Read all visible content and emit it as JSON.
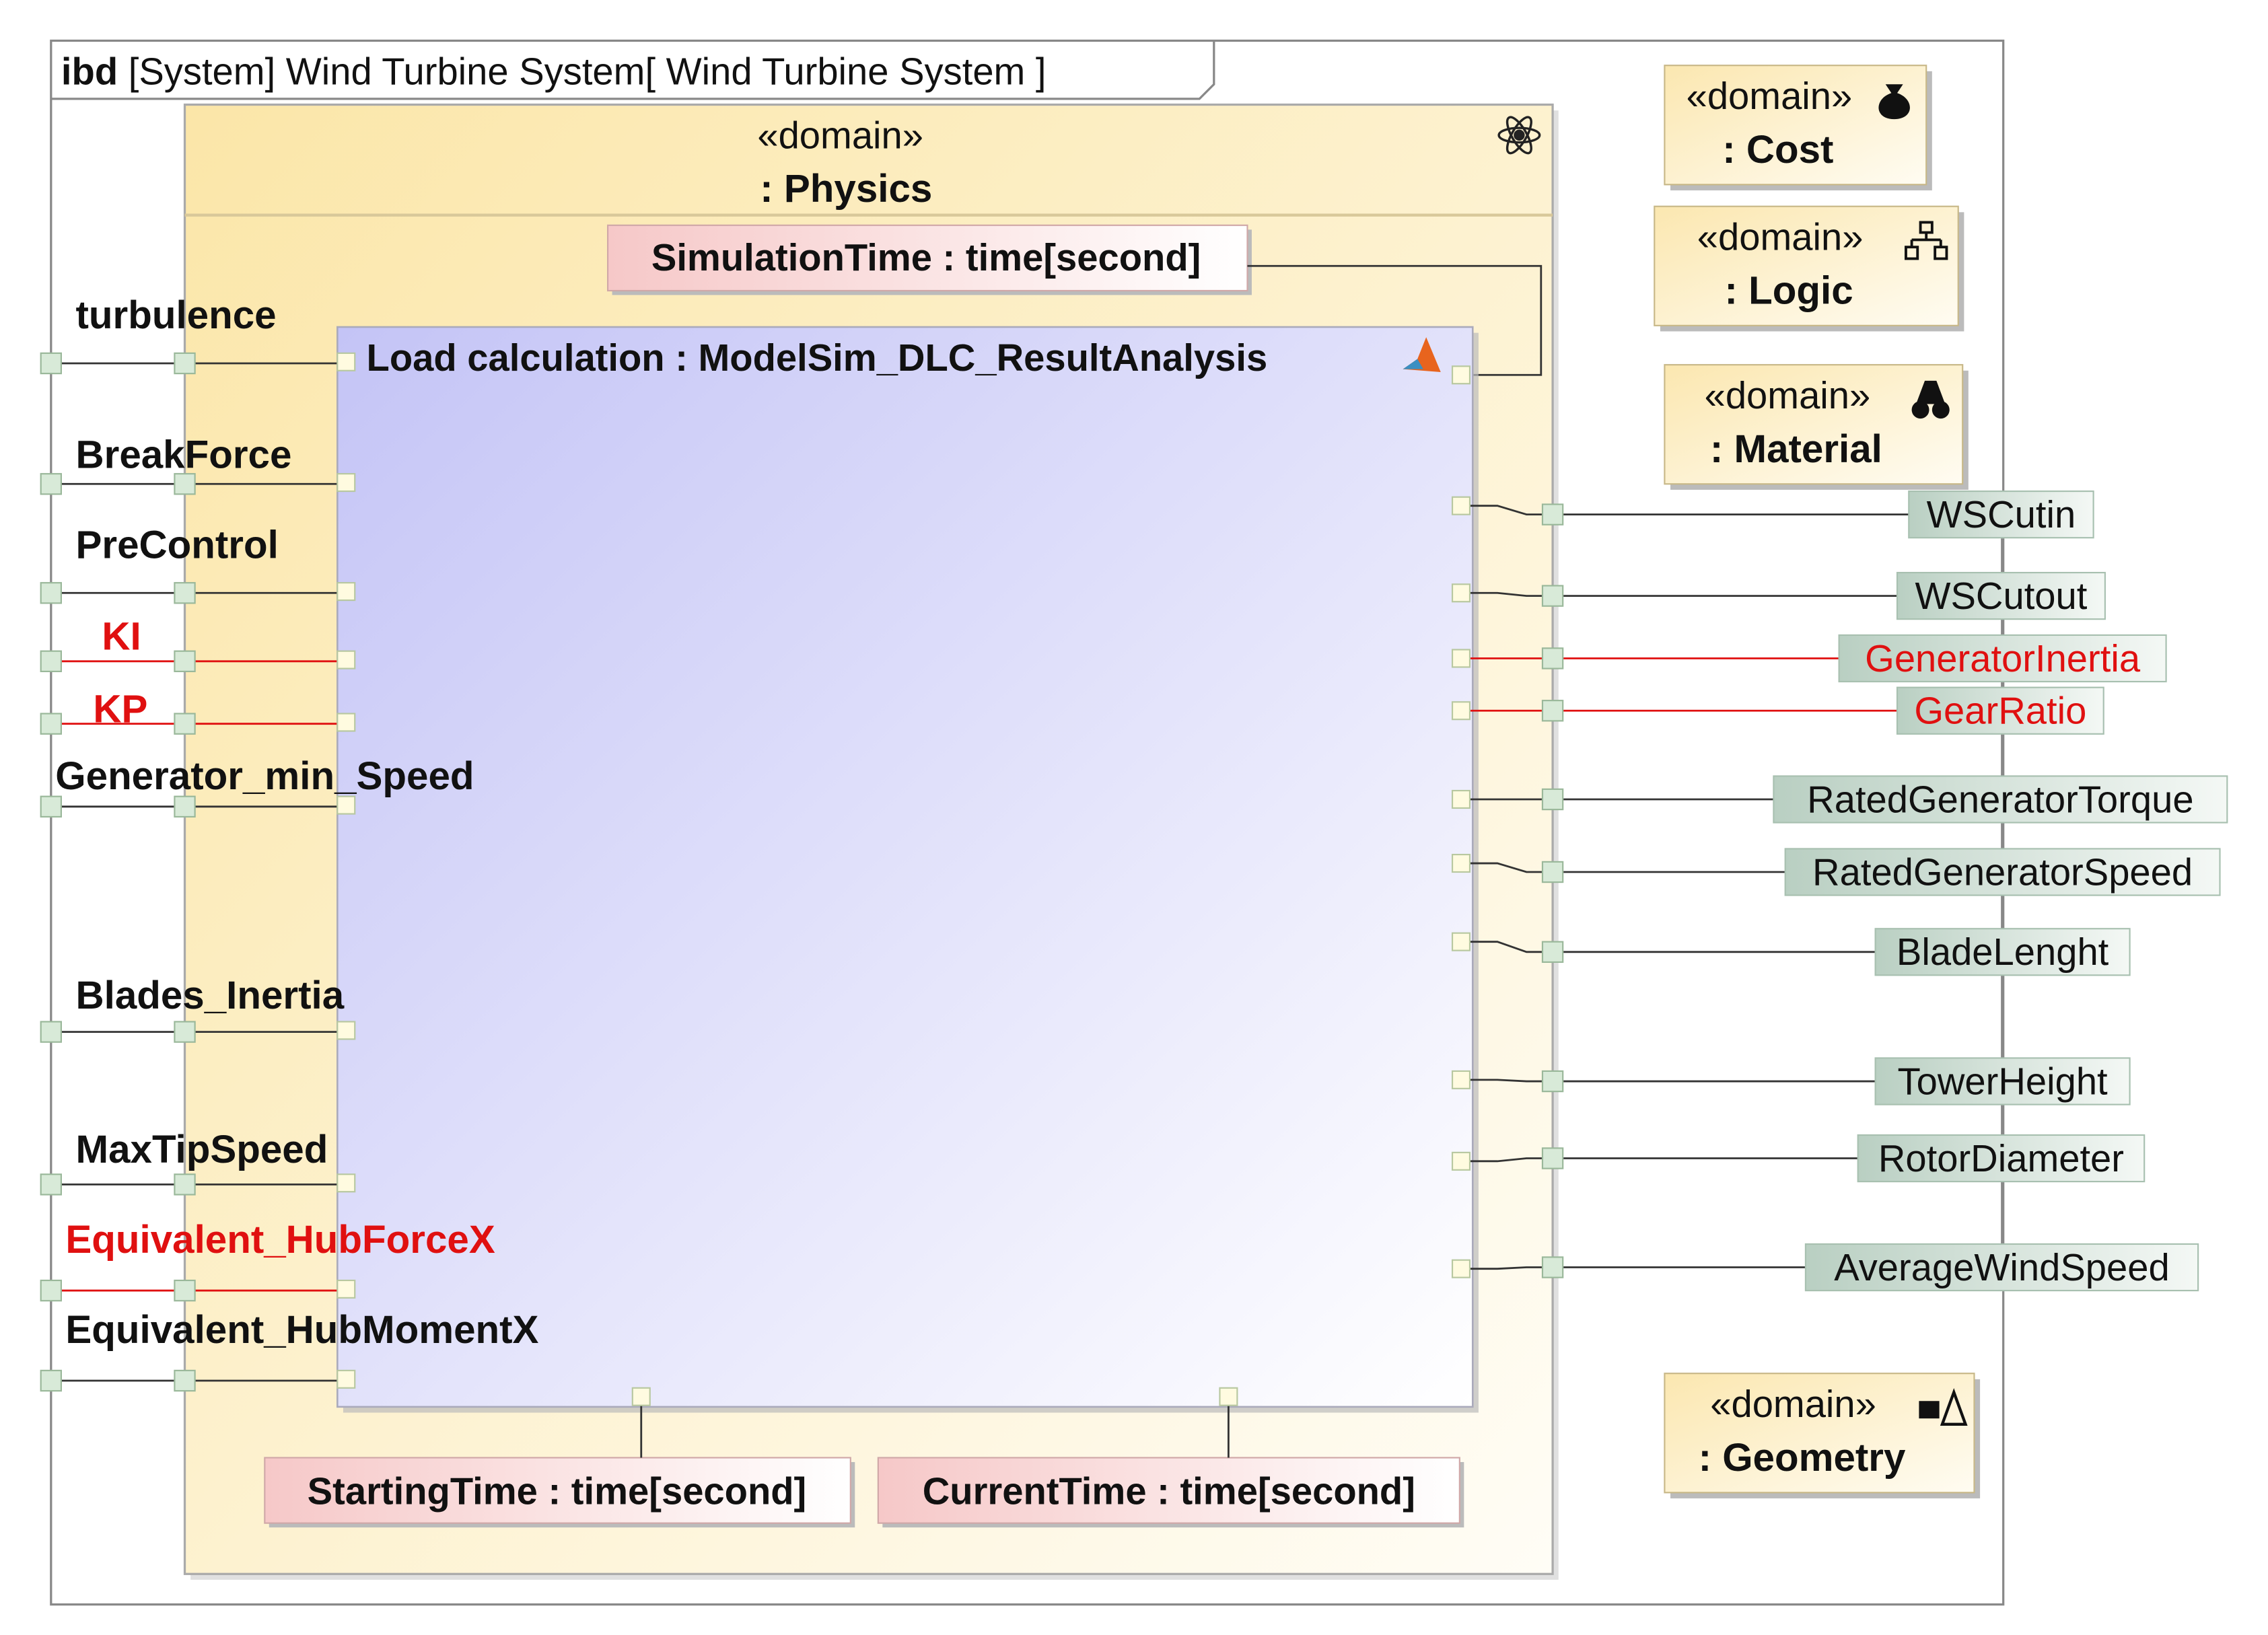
{
  "diagram": {
    "title": "ibd [System] Wind Turbine System[ Wind Turbine System ]",
    "physics": {
      "stereotype": "«domain»",
      "name": ": Physics",
      "icon": "atom-icon"
    },
    "load_block": {
      "title": "Load calculation : ModelSim_DLC_ResultAnalysis",
      "icon": "matlab-icon"
    },
    "simulation_time": "SimulationTime : time[second]",
    "starting_time": "StartingTime : time[second]",
    "current_time": "CurrentTime : time[second]",
    "domains": [
      {
        "stereotype": "«domain»",
        "name": ": Cost",
        "icon": "money-bag-icon"
      },
      {
        "stereotype": "«domain»",
        "name": ": Logic",
        "icon": "hierarchy-icon"
      },
      {
        "stereotype": "«domain»",
        "name": ": Material",
        "icon": "material-icon"
      },
      {
        "stereotype": "«domain»",
        "name": ": Geometry",
        "icon": "geometry-icon"
      }
    ],
    "left_ports": [
      {
        "label": "turbulence",
        "color": "#111111"
      },
      {
        "label": "BreakForce",
        "color": "#111111"
      },
      {
        "label": "PreControl",
        "color": "#111111"
      },
      {
        "label": "KI",
        "color": "#e01010"
      },
      {
        "label": "KP",
        "color": "#e01010"
      },
      {
        "label": "Generator_min_Speed",
        "color": "#111111"
      },
      {
        "label": "Blades_Inertia",
        "color": "#111111"
      },
      {
        "label": "MaxTipSpeed",
        "color": "#111111"
      },
      {
        "label": "Equivalent_HubForceX",
        "color": "#e01010"
      },
      {
        "label": "Equivalent_HubMomentX",
        "color": "#111111"
      }
    ],
    "right_ports": [
      {
        "label": "WSCutin",
        "color": "#111111"
      },
      {
        "label": "WSCutout",
        "color": "#111111"
      },
      {
        "label": "GeneratorInertia",
        "color": "#e01010"
      },
      {
        "label": "GearRatio",
        "color": "#e01010"
      },
      {
        "label": "RatedGeneratorTorque",
        "color": "#111111"
      },
      {
        "label": "RatedGeneratorSpeed",
        "color": "#111111"
      },
      {
        "label": "BladeLenght",
        "color": "#111111"
      },
      {
        "label": "TowerHeight",
        "color": "#111111"
      },
      {
        "label": "RotorDiameter",
        "color": "#111111"
      },
      {
        "label": "AverageWindSpeed",
        "color": "#111111"
      }
    ]
  }
}
